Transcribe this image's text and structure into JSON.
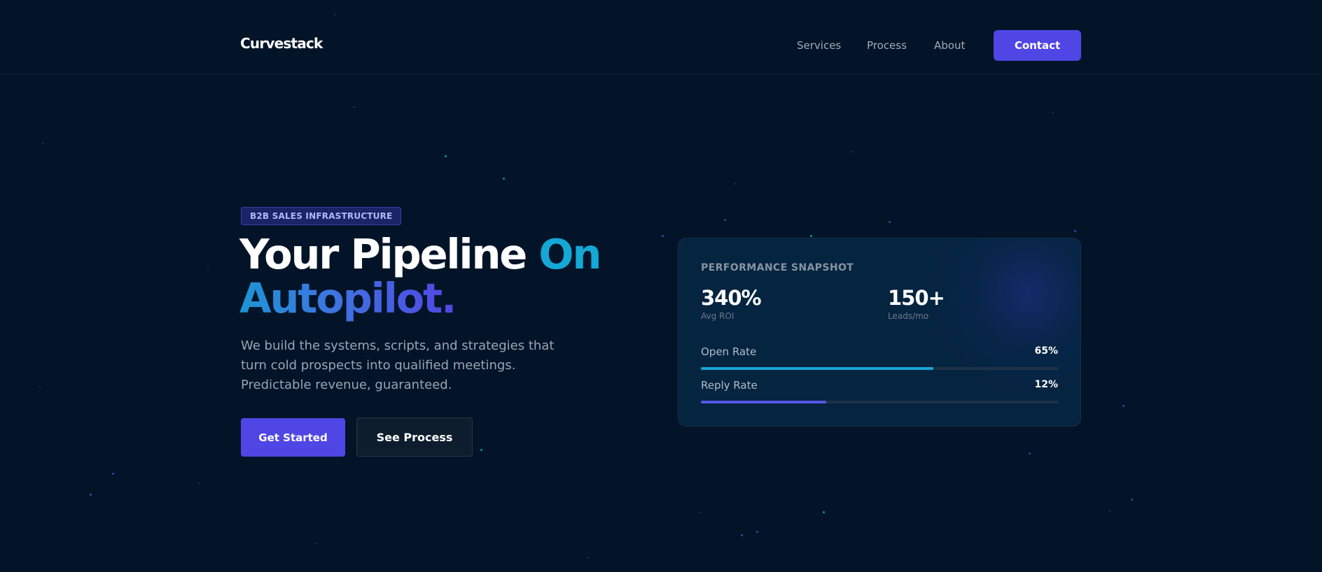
{
  "nav": {
    "brand": "Curvestack",
    "links": [
      "Services",
      "Process",
      "About"
    ],
    "contact_label": "Contact"
  },
  "hero": {
    "badge": "B2B SALES INFRASTRUCTURE",
    "headline_part1": "Your Pipeline ",
    "headline_accent1": "On",
    "headline_accent2": "Autopilot.",
    "subtitle": "We build the systems, scripts, and strategies that turn cold prospects into qualified meetings. Predictable revenue, guaranteed.",
    "primary_cta": "Get Started",
    "secondary_cta": "See Process"
  },
  "card": {
    "title": "PERFORMANCE SNAPSHOT",
    "stats": [
      {
        "value": "340%",
        "label": "Avg ROI"
      },
      {
        "value": "150+",
        "label": "Leads/mo"
      }
    ],
    "metrics": [
      {
        "label": "Open Rate",
        "value": "65%",
        "fraction": 0.65
      },
      {
        "label": "Reply Rate",
        "value": "12%",
        "fraction": 0.35
      }
    ]
  },
  "colors": {
    "background": "#031428",
    "accent_primary": "#4f46e5",
    "accent_cyan": "#14a8d6"
  }
}
